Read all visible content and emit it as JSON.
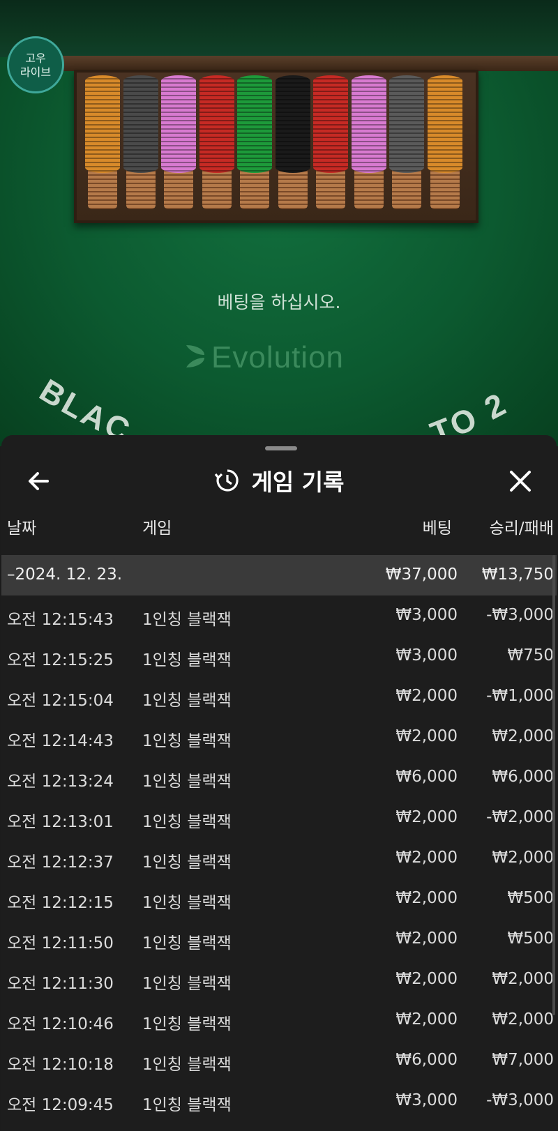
{
  "scene": {
    "logo": {
      "line1": "고우",
      "line2": "라이브"
    },
    "prompt": "베팅을 하십시오.",
    "brand": "Evolution",
    "arc_left": "BLAC",
    "arc_right": "TO 2",
    "chip_colors": [
      "#d88a2a",
      "#4a4a4a",
      "#d87ad0",
      "#c62a24",
      "#1d9a3a",
      "#1a1a1a",
      "#c62a24",
      "#d87ad0",
      "#5a5a5a",
      "#d88a2a"
    ]
  },
  "sheet": {
    "title": "게임 기록",
    "icons": {
      "back": "back-arrow-icon",
      "history": "history-icon",
      "close": "close-icon"
    },
    "columns": {
      "date": "날짜",
      "game": "게임",
      "bet": "베팅",
      "win_loss": "승리/패배"
    },
    "group": {
      "date": "–2024. 12. 23.",
      "bet": "₩37,000",
      "win_loss": "₩13,750"
    },
    "rows": [
      {
        "time": "오전 12:15:43",
        "game": "1인칭 블랙잭",
        "bet": "₩3,000",
        "win_loss": "-₩3,000"
      },
      {
        "time": "오전 12:15:25",
        "game": "1인칭 블랙잭",
        "bet": "₩3,000",
        "win_loss": "₩750"
      },
      {
        "time": "오전 12:15:04",
        "game": "1인칭 블랙잭",
        "bet": "₩2,000",
        "win_loss": "-₩1,000"
      },
      {
        "time": "오전 12:14:43",
        "game": "1인칭 블랙잭",
        "bet": "₩2,000",
        "win_loss": "₩2,000"
      },
      {
        "time": "오전 12:13:24",
        "game": "1인칭 블랙잭",
        "bet": "₩6,000",
        "win_loss": "₩6,000"
      },
      {
        "time": "오전 12:13:01",
        "game": "1인칭 블랙잭",
        "bet": "₩2,000",
        "win_loss": "-₩2,000"
      },
      {
        "time": "오전 12:12:37",
        "game": "1인칭 블랙잭",
        "bet": "₩2,000",
        "win_loss": "₩2,000"
      },
      {
        "time": "오전 12:12:15",
        "game": "1인칭 블랙잭",
        "bet": "₩2,000",
        "win_loss": "₩500"
      },
      {
        "time": "오전 12:11:50",
        "game": "1인칭 블랙잭",
        "bet": "₩2,000",
        "win_loss": "₩500"
      },
      {
        "time": "오전 12:11:30",
        "game": "1인칭 블랙잭",
        "bet": "₩2,000",
        "win_loss": "₩2,000"
      },
      {
        "time": "오전 12:10:46",
        "game": "1인칭 블랙잭",
        "bet": "₩2,000",
        "win_loss": "₩2,000"
      },
      {
        "time": "오전 12:10:18",
        "game": "1인칭 블랙잭",
        "bet": "₩6,000",
        "win_loss": "₩7,000"
      },
      {
        "time": "오전 12:09:45",
        "game": "1인칭 블랙잭",
        "bet": "₩3,000",
        "win_loss": "-₩3,000"
      }
    ]
  }
}
